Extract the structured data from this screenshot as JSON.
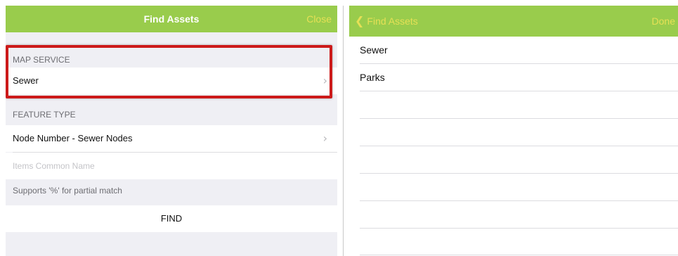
{
  "left": {
    "nav": {
      "title": "Find Assets",
      "close_label": "Close"
    },
    "map_service": {
      "header": "MAP SERVICE",
      "value": "Sewer"
    },
    "feature_type": {
      "header": "FEATURE TYPE",
      "value": "Node Number - Sewer Nodes"
    },
    "search": {
      "placeholder": "Items Common Name",
      "hint": "Supports '%' for partial match"
    },
    "find_label": "FIND"
  },
  "right": {
    "nav": {
      "back_label": "Find Assets",
      "done_label": "Done"
    },
    "items": [
      {
        "label": "Sewer"
      },
      {
        "label": "Parks"
      }
    ]
  },
  "colors": {
    "nav_bg": "#99cc4c",
    "nav_button": "#e6e055",
    "highlight": "#cc1a1a"
  },
  "icons": {
    "chevron_right": "chevron-right-icon",
    "chevron_left": "chevron-left-icon"
  }
}
